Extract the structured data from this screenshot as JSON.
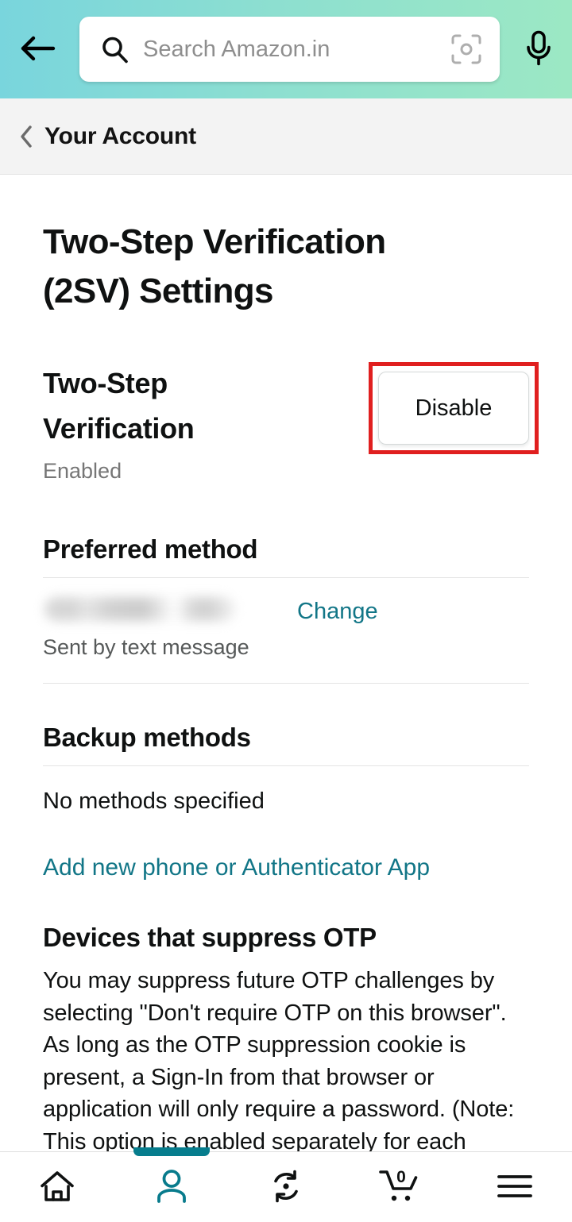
{
  "header": {
    "back_icon": "arrow-left-icon",
    "search": {
      "placeholder": "Search Amazon.in",
      "value": "",
      "search_icon": "search-icon",
      "lens_icon": "camera-lens-scan-icon"
    },
    "mic_icon": "microphone-icon",
    "gradient_start": "#79d5dd",
    "gradient_end": "#9ce8c4"
  },
  "breadcrumb": {
    "chevron_icon": "chevron-left-icon",
    "label": "Your Account"
  },
  "main": {
    "page_title": "Two-Step Verification (2SV) Settings",
    "status": {
      "heading": "Two-Step Verification",
      "value": "Enabled",
      "button_label": "Disable",
      "highlight_color": "#e01f1f"
    },
    "preferred_method": {
      "heading": "Preferred method",
      "value_redacted": "",
      "sub_label": "Sent by text message",
      "change_label": "Change"
    },
    "backup_methods": {
      "heading": "Backup methods",
      "status_text": "No methods specified",
      "add_link_label": "Add new phone or Authenticator App"
    },
    "suppress_otp": {
      "heading": "Devices that suppress OTP",
      "paragraph": "You may suppress future OTP challenges by selecting \"Don't require OTP on this browser\". As long as the OTP suppression cookie is present, a Sign-In from that browser or application will only require a password. (Note: This option is enabled separately for each browser that you use.)"
    },
    "link_color": "#127687"
  },
  "bottom_nav": {
    "active_index": 1,
    "active_color": "#067d8d",
    "items": [
      {
        "name": "home",
        "icon": "home-icon",
        "badge": ""
      },
      {
        "name": "account",
        "icon": "person-icon",
        "badge": ""
      },
      {
        "name": "buy-again",
        "icon": "refresh-circular-icon",
        "badge": ""
      },
      {
        "name": "cart",
        "icon": "shopping-cart-icon",
        "badge": "0"
      },
      {
        "name": "menu",
        "icon": "hamburger-menu-icon",
        "badge": ""
      }
    ]
  }
}
